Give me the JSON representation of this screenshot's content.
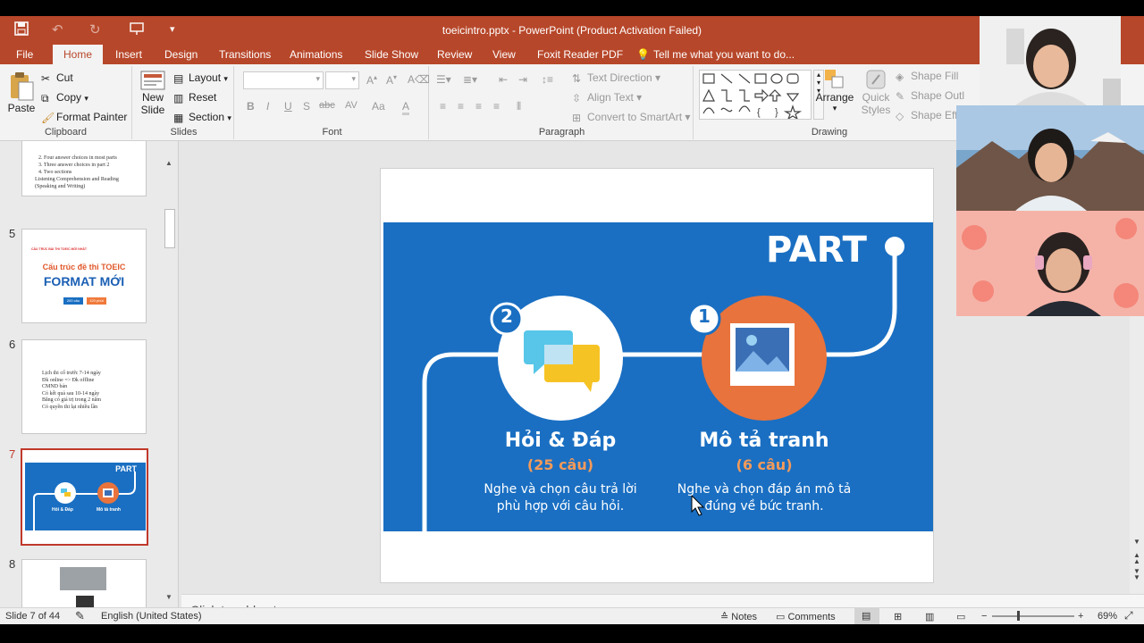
{
  "window": {
    "title": "toeicintro.pptx - PowerPoint (Product Activation Failed)"
  },
  "tabs": [
    "File",
    "Home",
    "Insert",
    "Design",
    "Transitions",
    "Animations",
    "Slide Show",
    "Review",
    "View",
    "Foxit Reader PDF"
  ],
  "tell_me": "Tell me what you want to do...",
  "ribbon": {
    "clipboard": {
      "label": "Clipboard",
      "paste": "Paste",
      "cut": "Cut",
      "copy": "Copy",
      "format_painter": "Format Painter"
    },
    "slides": {
      "label": "Slides",
      "new_slide_1": "New",
      "new_slide_2": "Slide",
      "layout": "Layout",
      "reset": "Reset",
      "section": "Section"
    },
    "font": {
      "label": "Font",
      "bold": "B",
      "italic": "I",
      "underline": "U",
      "shadow": "S",
      "strike": "abc",
      "spacing": "AV",
      "case": "Aa",
      "color": "A"
    },
    "paragraph": {
      "label": "Paragraph",
      "text_direction": "Text Direction",
      "align_text": "Align Text",
      "convert_smartart": "Convert to SmartArt"
    },
    "drawing": {
      "label": "Drawing",
      "arrange": "Arrange",
      "quick_styles_1": "Quick",
      "quick_styles_2": "Styles",
      "shape_fill": "Shape Fill",
      "shape_outline": "Shape Outl",
      "shape_effects": "Shape Effe"
    }
  },
  "thumbnails": {
    "t4_lines": [
      "2. Four answer choices in most parts",
      "3. Three answer choices in part 2",
      "4. Two sections",
      "Listening Comprehension and Reading",
      "(Speaking and Writing)"
    ],
    "t5": {
      "num": "5",
      "small": "CẤU TRÚC BÀI THI TOEIC MỚI NHẤT",
      "title1": "Cấu trúc đề thi TOEIC",
      "title2": "FORMAT MỚI",
      "chip1": "200 câu",
      "chip2": "120 phút"
    },
    "t6": {
      "num": "6",
      "lines": [
        "Lịch thi cố trước 7-14 ngày",
        "Đk online => Đk offline",
        "CMND bản",
        "Có kết quả sau 10-14 ngày",
        "Bằng có giá trị trong 2 năm",
        "Có quyền thi lại nhiều lần"
      ]
    },
    "t7": {
      "num": "7",
      "part": "PART",
      "c1": "Hỏi & Đáp",
      "c2": "Mô tả tranh"
    },
    "t8": {
      "num": "8"
    }
  },
  "slide": {
    "part": "PART",
    "left": {
      "badge": "2",
      "title": "Hỏi & Đáp",
      "count": "(25 câu)",
      "desc1": "Nghe và chọn câu trả lời",
      "desc2": "phù hợp với câu hỏi."
    },
    "right": {
      "badge": "1",
      "title": "Mô tả tranh",
      "count": "(6 câu)",
      "desc1": "Nghe và chọn đáp án mô tả",
      "desc2": "đúng về bức tranh."
    }
  },
  "notes": {
    "placeholder": "Click to add notes"
  },
  "status": {
    "slide": "Slide 7 of 44",
    "language": "English (United States)",
    "notes": "Notes",
    "comments": "Comments",
    "zoom": "69%"
  },
  "colors": {
    "accent": "#b7472a",
    "slide_blue": "#1a6fc2",
    "orange": "#e8733c",
    "orange_text": "#f39a5a"
  }
}
